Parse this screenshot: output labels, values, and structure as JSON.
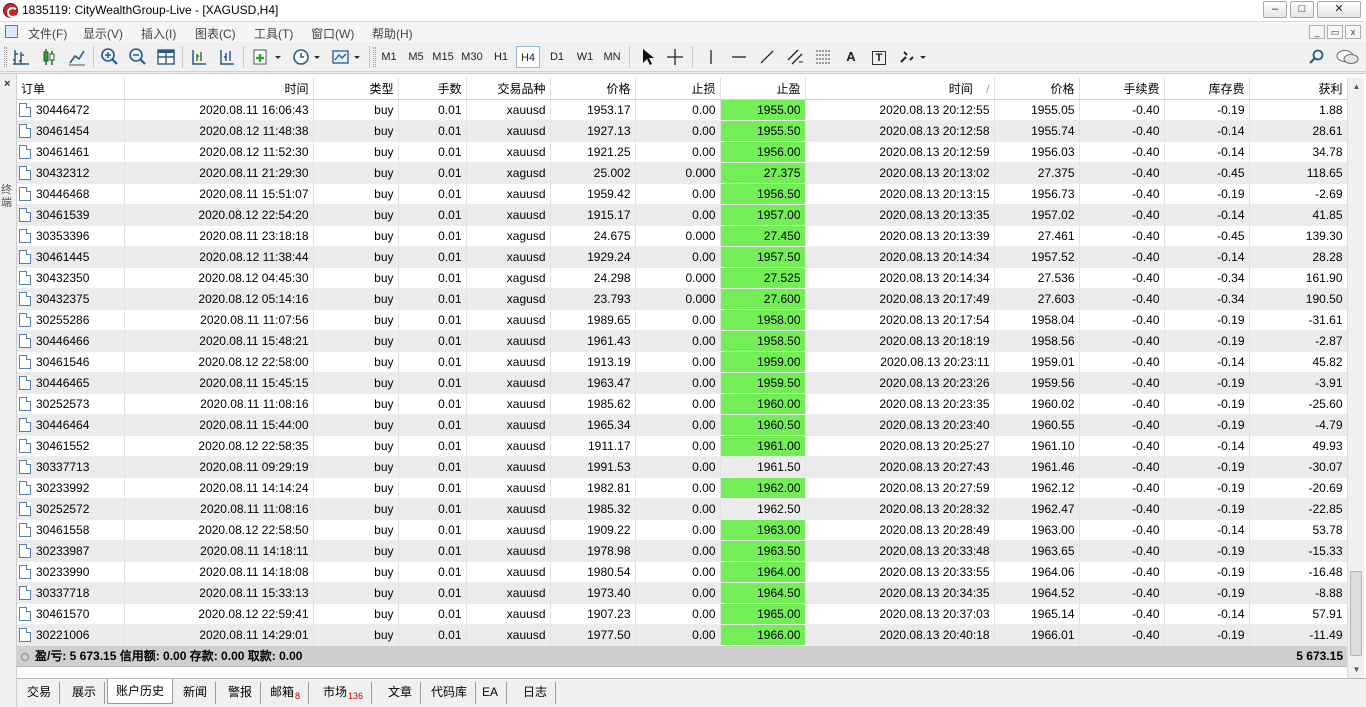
{
  "window": {
    "title": "1835119: CityWealthGroup-Live - [XAGUSD,H4]",
    "controls": [
      "–",
      "□",
      "✕"
    ]
  },
  "menu": {
    "items": [
      "文件(F)",
      "显示(V)",
      "插入(I)",
      "图表(C)",
      "工具(T)",
      "窗口(W)",
      "帮助(H)"
    ],
    "mdi_controls": [
      "_",
      "▭",
      "x"
    ]
  },
  "toolbar": {
    "timeframes": [
      "M1",
      "M5",
      "M15",
      "M30",
      "H1",
      "H4",
      "D1",
      "W1",
      "MN"
    ],
    "active_timeframe": "H4",
    "text_tool": "A",
    "text_label_tool": "T"
  },
  "panel": {
    "close_label": "×",
    "side_label": "终端"
  },
  "table": {
    "columns": [
      "订单",
      "时间",
      "类型",
      "手数",
      "交易品种",
      "价格",
      "止损",
      "止盈",
      "时间",
      "价格",
      "手续费",
      "库存费",
      "获利"
    ],
    "sort_indicator": "/",
    "rows": [
      {
        "order": "30446472",
        "open_time": "2020.08.11 16:06:43",
        "type": "buy",
        "volume": "0.01",
        "symbol": "xauusd",
        "price": "1953.17",
        "sl": "0.00",
        "tp": "1955.00",
        "tp_hit": true,
        "close_time": "2020.08.13 20:12:55",
        "close_price": "1955.05",
        "commission": "-0.40",
        "swap": "-0.19",
        "profit": "1.88"
      },
      {
        "order": "30461454",
        "open_time": "2020.08.12 11:48:38",
        "type": "buy",
        "volume": "0.01",
        "symbol": "xauusd",
        "price": "1927.13",
        "sl": "0.00",
        "tp": "1955.50",
        "tp_hit": true,
        "close_time": "2020.08.13 20:12:58",
        "close_price": "1955.74",
        "commission": "-0.40",
        "swap": "-0.14",
        "profit": "28.61"
      },
      {
        "order": "30461461",
        "open_time": "2020.08.12 11:52:30",
        "type": "buy",
        "volume": "0.01",
        "symbol": "xauusd",
        "price": "1921.25",
        "sl": "0.00",
        "tp": "1956.00",
        "tp_hit": true,
        "close_time": "2020.08.13 20:12:59",
        "close_price": "1956.03",
        "commission": "-0.40",
        "swap": "-0.14",
        "profit": "34.78"
      },
      {
        "order": "30432312",
        "open_time": "2020.08.11 21:29:30",
        "type": "buy",
        "volume": "0.01",
        "symbol": "xagusd",
        "price": "25.002",
        "sl": "0.000",
        "tp": "27.375",
        "tp_hit": true,
        "close_time": "2020.08.13 20:13:02",
        "close_price": "27.375",
        "commission": "-0.40",
        "swap": "-0.45",
        "profit": "118.65"
      },
      {
        "order": "30446468",
        "open_time": "2020.08.11 15:51:07",
        "type": "buy",
        "volume": "0.01",
        "symbol": "xauusd",
        "price": "1959.42",
        "sl": "0.00",
        "tp": "1956.50",
        "tp_hit": true,
        "close_time": "2020.08.13 20:13:15",
        "close_price": "1956.73",
        "commission": "-0.40",
        "swap": "-0.19",
        "profit": "-2.69"
      },
      {
        "order": "30461539",
        "open_time": "2020.08.12 22:54:20",
        "type": "buy",
        "volume": "0.01",
        "symbol": "xauusd",
        "price": "1915.17",
        "sl": "0.00",
        "tp": "1957.00",
        "tp_hit": true,
        "close_time": "2020.08.13 20:13:35",
        "close_price": "1957.02",
        "commission": "-0.40",
        "swap": "-0.14",
        "profit": "41.85"
      },
      {
        "order": "30353396",
        "open_time": "2020.08.11 23:18:18",
        "type": "buy",
        "volume": "0.01",
        "symbol": "xagusd",
        "price": "24.675",
        "sl": "0.000",
        "tp": "27.450",
        "tp_hit": true,
        "close_time": "2020.08.13 20:13:39",
        "close_price": "27.461",
        "commission": "-0.40",
        "swap": "-0.45",
        "profit": "139.30"
      },
      {
        "order": "30461445",
        "open_time": "2020.08.12 11:38:44",
        "type": "buy",
        "volume": "0.01",
        "symbol": "xauusd",
        "price": "1929.24",
        "sl": "0.00",
        "tp": "1957.50",
        "tp_hit": true,
        "close_time": "2020.08.13 20:14:34",
        "close_price": "1957.52",
        "commission": "-0.40",
        "swap": "-0.14",
        "profit": "28.28"
      },
      {
        "order": "30432350",
        "open_time": "2020.08.12 04:45:30",
        "type": "buy",
        "volume": "0.01",
        "symbol": "xagusd",
        "price": "24.298",
        "sl": "0.000",
        "tp": "27.525",
        "tp_hit": true,
        "close_time": "2020.08.13 20:14:34",
        "close_price": "27.536",
        "commission": "-0.40",
        "swap": "-0.34",
        "profit": "161.90"
      },
      {
        "order": "30432375",
        "open_time": "2020.08.12 05:14:16",
        "type": "buy",
        "volume": "0.01",
        "symbol": "xagusd",
        "price": "23.793",
        "sl": "0.000",
        "tp": "27.600",
        "tp_hit": true,
        "close_time": "2020.08.13 20:17:49",
        "close_price": "27.603",
        "commission": "-0.40",
        "swap": "-0.34",
        "profit": "190.50"
      },
      {
        "order": "30255286",
        "open_time": "2020.08.11 11:07:56",
        "type": "buy",
        "volume": "0.01",
        "symbol": "xauusd",
        "price": "1989.65",
        "sl": "0.00",
        "tp": "1958.00",
        "tp_hit": true,
        "close_time": "2020.08.13 20:17:54",
        "close_price": "1958.04",
        "commission": "-0.40",
        "swap": "-0.19",
        "profit": "-31.61"
      },
      {
        "order": "30446466",
        "open_time": "2020.08.11 15:48:21",
        "type": "buy",
        "volume": "0.01",
        "symbol": "xauusd",
        "price": "1961.43",
        "sl": "0.00",
        "tp": "1958.50",
        "tp_hit": true,
        "close_time": "2020.08.13 20:18:19",
        "close_price": "1958.56",
        "commission": "-0.40",
        "swap": "-0.19",
        "profit": "-2.87"
      },
      {
        "order": "30461546",
        "open_time": "2020.08.12 22:58:00",
        "type": "buy",
        "volume": "0.01",
        "symbol": "xauusd",
        "price": "1913.19",
        "sl": "0.00",
        "tp": "1959.00",
        "tp_hit": true,
        "close_time": "2020.08.13 20:23:11",
        "close_price": "1959.01",
        "commission": "-0.40",
        "swap": "-0.14",
        "profit": "45.82"
      },
      {
        "order": "30446465",
        "open_time": "2020.08.11 15:45:15",
        "type": "buy",
        "volume": "0.01",
        "symbol": "xauusd",
        "price": "1963.47",
        "sl": "0.00",
        "tp": "1959.50",
        "tp_hit": true,
        "close_time": "2020.08.13 20:23:26",
        "close_price": "1959.56",
        "commission": "-0.40",
        "swap": "-0.19",
        "profit": "-3.91"
      },
      {
        "order": "30252573",
        "open_time": "2020.08.11 11:08:16",
        "type": "buy",
        "volume": "0.01",
        "symbol": "xauusd",
        "price": "1985.62",
        "sl": "0.00",
        "tp": "1960.00",
        "tp_hit": true,
        "close_time": "2020.08.13 20:23:35",
        "close_price": "1960.02",
        "commission": "-0.40",
        "swap": "-0.19",
        "profit": "-25.60"
      },
      {
        "order": "30446464",
        "open_time": "2020.08.11 15:44:00",
        "type": "buy",
        "volume": "0.01",
        "symbol": "xauusd",
        "price": "1965.34",
        "sl": "0.00",
        "tp": "1960.50",
        "tp_hit": true,
        "close_time": "2020.08.13 20:23:40",
        "close_price": "1960.55",
        "commission": "-0.40",
        "swap": "-0.19",
        "profit": "-4.79"
      },
      {
        "order": "30461552",
        "open_time": "2020.08.12 22:58:35",
        "type": "buy",
        "volume": "0.01",
        "symbol": "xauusd",
        "price": "1911.17",
        "sl": "0.00",
        "tp": "1961.00",
        "tp_hit": true,
        "close_time": "2020.08.13 20:25:27",
        "close_price": "1961.10",
        "commission": "-0.40",
        "swap": "-0.14",
        "profit": "49.93"
      },
      {
        "order": "30337713",
        "open_time": "2020.08.11 09:29:19",
        "type": "buy",
        "volume": "0.01",
        "symbol": "xauusd",
        "price": "1991.53",
        "sl": "0.00",
        "tp": "1961.50",
        "tp_hit": false,
        "close_time": "2020.08.13 20:27:43",
        "close_price": "1961.46",
        "commission": "-0.40",
        "swap": "-0.19",
        "profit": "-30.07"
      },
      {
        "order": "30233992",
        "open_time": "2020.08.11 14:14:24",
        "type": "buy",
        "volume": "0.01",
        "symbol": "xauusd",
        "price": "1982.81",
        "sl": "0.00",
        "tp": "1962.00",
        "tp_hit": true,
        "close_time": "2020.08.13 20:27:59",
        "close_price": "1962.12",
        "commission": "-0.40",
        "swap": "-0.19",
        "profit": "-20.69"
      },
      {
        "order": "30252572",
        "open_time": "2020.08.11 11:08:16",
        "type": "buy",
        "volume": "0.01",
        "symbol": "xauusd",
        "price": "1985.32",
        "sl": "0.00",
        "tp": "1962.50",
        "tp_hit": false,
        "close_time": "2020.08.13 20:28:32",
        "close_price": "1962.47",
        "commission": "-0.40",
        "swap": "-0.19",
        "profit": "-22.85"
      },
      {
        "order": "30461558",
        "open_time": "2020.08.12 22:58:50",
        "type": "buy",
        "volume": "0.01",
        "symbol": "xauusd",
        "price": "1909.22",
        "sl": "0.00",
        "tp": "1963.00",
        "tp_hit": true,
        "close_time": "2020.08.13 20:28:49",
        "close_price": "1963.00",
        "commission": "-0.40",
        "swap": "-0.14",
        "profit": "53.78"
      },
      {
        "order": "30233987",
        "open_time": "2020.08.11 14:18:11",
        "type": "buy",
        "volume": "0.01",
        "symbol": "xauusd",
        "price": "1978.98",
        "sl": "0.00",
        "tp": "1963.50",
        "tp_hit": true,
        "close_time": "2020.08.13 20:33:48",
        "close_price": "1963.65",
        "commission": "-0.40",
        "swap": "-0.19",
        "profit": "-15.33"
      },
      {
        "order": "30233990",
        "open_time": "2020.08.11 14:18:08",
        "type": "buy",
        "volume": "0.01",
        "symbol": "xauusd",
        "price": "1980.54",
        "sl": "0.00",
        "tp": "1964.00",
        "tp_hit": true,
        "close_time": "2020.08.13 20:33:55",
        "close_price": "1964.06",
        "commission": "-0.40",
        "swap": "-0.19",
        "profit": "-16.48"
      },
      {
        "order": "30337718",
        "open_time": "2020.08.11 15:33:13",
        "type": "buy",
        "volume": "0.01",
        "symbol": "xauusd",
        "price": "1973.40",
        "sl": "0.00",
        "tp": "1964.50",
        "tp_hit": true,
        "close_time": "2020.08.13 20:34:35",
        "close_price": "1964.52",
        "commission": "-0.40",
        "swap": "-0.19",
        "profit": "-8.88"
      },
      {
        "order": "30461570",
        "open_time": "2020.08.12 22:59:41",
        "type": "buy",
        "volume": "0.01",
        "symbol": "xauusd",
        "price": "1907.23",
        "sl": "0.00",
        "tp": "1965.00",
        "tp_hit": true,
        "close_time": "2020.08.13 20:37:03",
        "close_price": "1965.14",
        "commission": "-0.40",
        "swap": "-0.14",
        "profit": "57.91"
      },
      {
        "order": "30221006",
        "open_time": "2020.08.11 14:29:01",
        "type": "buy",
        "volume": "0.01",
        "symbol": "xauusd",
        "price": "1977.50",
        "sl": "0.00",
        "tp": "1966.00",
        "tp_hit": true,
        "close_time": "2020.08.13 20:40:18",
        "close_price": "1966.01",
        "commission": "-0.40",
        "swap": "-0.19",
        "profit": "-11.49"
      }
    ],
    "summary": {
      "text": "盈/亏: 5 673.15  信用额: 0.00  存款: 0.00  取款: 0.00",
      "total": "5 673.15"
    }
  },
  "tabs": [
    {
      "label": "交易",
      "badge": ""
    },
    {
      "label": "展示",
      "badge": ""
    },
    {
      "label": "账户历史",
      "badge": "",
      "active": true
    },
    {
      "label": "新闻",
      "badge": ""
    },
    {
      "label": "警报",
      "badge": ""
    },
    {
      "label": "邮箱",
      "badge": "8"
    },
    {
      "label": "市场",
      "badge": "136"
    },
    {
      "label": "文章",
      "badge": ""
    },
    {
      "label": "代码库",
      "badge": ""
    },
    {
      "label": "EA",
      "badge": ""
    },
    {
      "label": "日志",
      "badge": ""
    }
  ],
  "colors": {
    "tp_hit_green": "#73ee56",
    "row_alt": "#ebebeb",
    "summary_bg": "#cfcfcf",
    "badge_red": "#d00000"
  }
}
